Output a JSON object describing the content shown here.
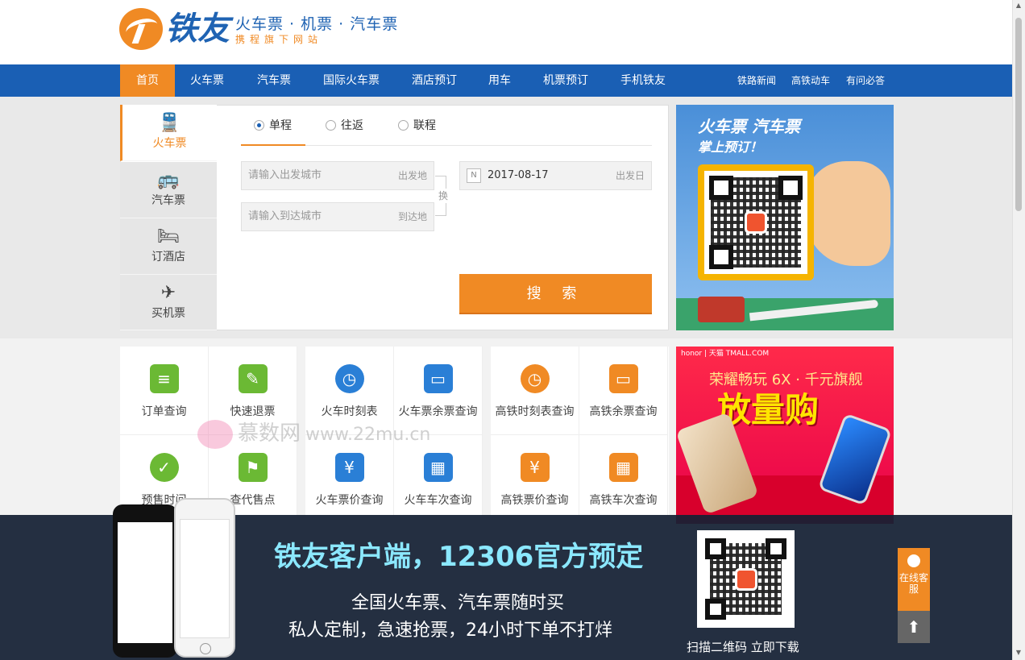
{
  "header": {
    "brand": "铁友",
    "slogan": "火车票 · 机票 · 汽车票",
    "sub_slogan": "携程旗下网站"
  },
  "nav": {
    "items": [
      "首页",
      "火车票",
      "汽车票",
      "国际火车票",
      "酒店预订",
      "用车",
      "机票预订",
      "手机铁友"
    ],
    "right_items": [
      "铁路新闻",
      "高铁动车",
      "有问必答"
    ],
    "active": "首页"
  },
  "booking": {
    "side_tabs": [
      {
        "label": "火车票",
        "icon": "train-icon"
      },
      {
        "label": "汽车票",
        "icon": "bus-icon"
      },
      {
        "label": "订酒店",
        "icon": "bed-icon"
      },
      {
        "label": "买机票",
        "icon": "plane-icon"
      }
    ],
    "trip_types": [
      "单程",
      "往返",
      "联程"
    ],
    "selected_trip": "单程",
    "from_placeholder": "请输入出发城市",
    "from_tag": "出发地",
    "to_placeholder": "请输入到达城市",
    "to_tag": "到达地",
    "swap_label": "换",
    "date_value": "2017-08-17",
    "date_tag": "出发日",
    "calendar_glyph": "N",
    "search_label": "搜 索"
  },
  "ads": {
    "qr_title": "火车票 汽车票",
    "qr_sub": "掌上预订！",
    "honor_top": "honor | 天猫 TMALL.COM",
    "honor_tagline": "荣耀畅玩 6X · 千元旗舰",
    "honor_big": "放量购"
  },
  "services": [
    {
      "label": "订单查询",
      "icon": "document-icon"
    },
    {
      "label": "快速退票",
      "icon": "edit-icon"
    },
    {
      "label": "火车时刻表",
      "icon": "clock-train-icon"
    },
    {
      "label": "火车票余票查询",
      "icon": "ticket-icon"
    },
    {
      "label": "高铁时刻表查询",
      "icon": "clock-train-icon"
    },
    {
      "label": "高铁余票查询",
      "icon": "ticket-icon"
    },
    {
      "label": "预售时间",
      "icon": "check-circle-icon"
    },
    {
      "label": "查代售点",
      "icon": "map-person-icon"
    },
    {
      "label": "火车票价查询",
      "icon": "price-card-icon"
    },
    {
      "label": "火车车次查询",
      "icon": "calendar-icon"
    },
    {
      "label": "高铁票价查询",
      "icon": "price-card-icon"
    },
    {
      "label": "高铁车次查询",
      "icon": "calendar-icon"
    }
  ],
  "watermark": {
    "text": "慕数网",
    "url": "www.22mu.cn"
  },
  "promo": {
    "title": "铁友客户端，12306官方预定",
    "line1": "全国火车票、汽车票随时买",
    "line2": "私人定制，急速抢票，24小时下单不打烊",
    "qr_label": "扫描二维码 立即下载"
  },
  "float": {
    "service_label": "在线客服",
    "top_glyph": "⬆"
  },
  "colors": {
    "brand_blue": "#1a5fb4",
    "accent_orange": "#f08a24",
    "promo_cyan": "#8be8ff"
  }
}
